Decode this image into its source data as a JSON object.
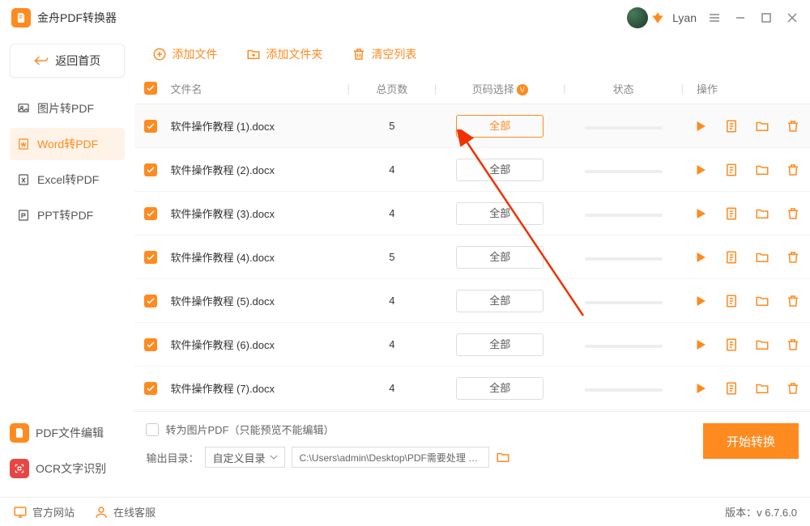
{
  "app": {
    "title": "金舟PDF转换器",
    "username": "Lyan"
  },
  "sidebar": {
    "back": "返回首页",
    "items": [
      {
        "icon": "image",
        "label": "图片转PDF"
      },
      {
        "icon": "word",
        "label": "Word转PDF"
      },
      {
        "icon": "excel",
        "label": "Excel转PDF"
      },
      {
        "icon": "ppt",
        "label": "PPT转PDF"
      }
    ],
    "activeIndex": 1,
    "bottom": [
      {
        "label": "PDF文件编辑"
      },
      {
        "label": "OCR文字识别"
      }
    ]
  },
  "toolbar": {
    "add_file": "添加文件",
    "add_folder": "添加文件夹",
    "clear": "清空列表"
  },
  "table": {
    "headers": {
      "filename": "文件名",
      "pages": "总页数",
      "range": "页码选择",
      "status": "状态",
      "ops": "操作"
    },
    "rows": [
      {
        "name": "软件操作教程 (1).docx",
        "pages": 5,
        "range": "全部"
      },
      {
        "name": "软件操作教程 (2).docx",
        "pages": 4,
        "range": "全部"
      },
      {
        "name": "软件操作教程 (3).docx",
        "pages": 4,
        "range": "全部"
      },
      {
        "name": "软件操作教程 (4).docx",
        "pages": 5,
        "range": "全部"
      },
      {
        "name": "软件操作教程 (5).docx",
        "pages": 4,
        "range": "全部"
      },
      {
        "name": "软件操作教程 (6).docx",
        "pages": 4,
        "range": "全部"
      },
      {
        "name": "软件操作教程 (7).docx",
        "pages": 4,
        "range": "全部"
      }
    ]
  },
  "bottom": {
    "img_pdf": "转为图片PDF（只能预览不能编辑）",
    "out_label": "输出目录：",
    "out_mode": "自定义目录",
    "out_path": "C:\\Users\\admin\\Desktop\\PDF需要处理 …",
    "start": "开始转换"
  },
  "footer": {
    "site": "官方网站",
    "support": "在线客服",
    "version": "版本：v 6.7.6.0"
  }
}
